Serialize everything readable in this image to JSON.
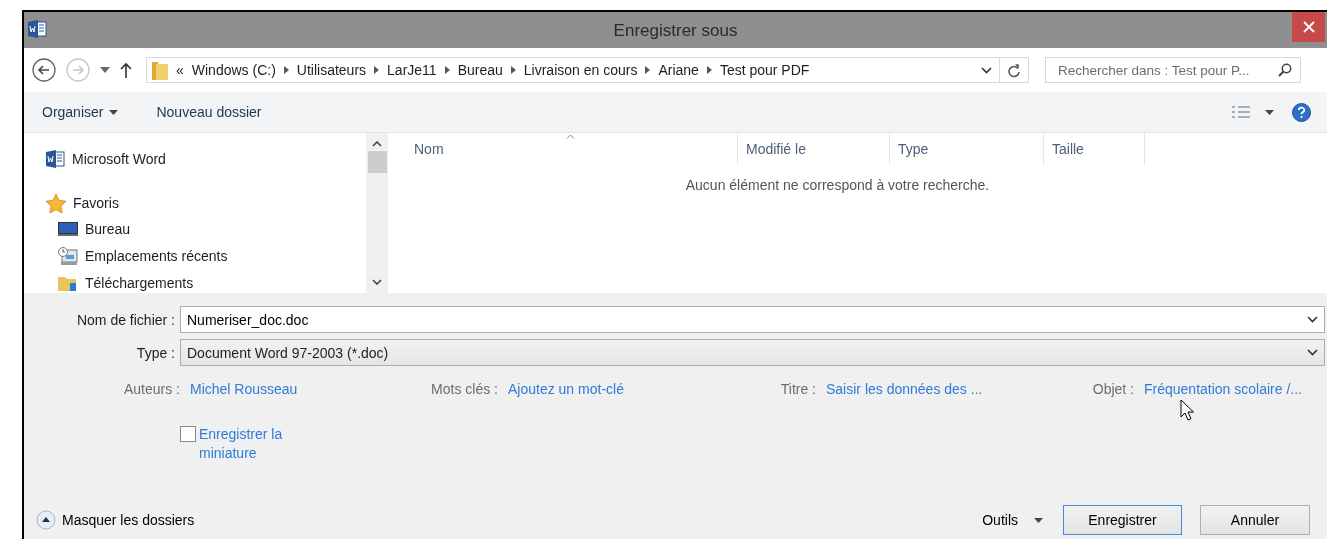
{
  "window": {
    "title": "Enregistrer sous"
  },
  "address": {
    "overflow": "«",
    "segments": [
      "Windows (C:)",
      "Utilisateurs",
      "LarJe11",
      "Bureau",
      "Livraison en cours",
      "Ariane",
      "Test pour PDF"
    ]
  },
  "search": {
    "placeholder": "Rechercher dans : Test pour P..."
  },
  "toolbar": {
    "organize": "Organiser",
    "new_folder": "Nouveau dossier"
  },
  "nav_pane": {
    "items": [
      {
        "label": "Microsoft Word",
        "kind": "word"
      },
      {
        "label": "Favoris",
        "kind": "star",
        "children": [
          {
            "label": "Bureau",
            "kind": "desktop"
          },
          {
            "label": "Emplacements récents",
            "kind": "recent"
          },
          {
            "label": "Téléchargements",
            "kind": "downloads"
          }
        ]
      }
    ]
  },
  "file_list": {
    "columns": [
      "Nom",
      "Modifié le",
      "Type",
      "Taille"
    ],
    "empty_message": "Aucun élément ne correspond à votre recherche."
  },
  "filename": {
    "label": "Nom de fichier :",
    "value": "Numeriser_doc.doc"
  },
  "file_type": {
    "label": "Type :",
    "value": "Document Word 97-2003 (*.doc)"
  },
  "properties": [
    {
      "label": "Auteurs :",
      "value": "Michel Rousseau"
    },
    {
      "label": "Mots clés :",
      "value": "Ajoutez un mot-clé"
    },
    {
      "label": "Titre :",
      "value": "Saisir les données des ..."
    },
    {
      "label": "Objet :",
      "value": "Fréquentation scolaire /..."
    }
  ],
  "thumbnail": {
    "label": "Enregistrer la miniature",
    "checked": false
  },
  "hide_folders": "Masquer les dossiers",
  "tools": "Outils",
  "buttons": [
    {
      "label": "Enregistrer",
      "kind": "primary"
    },
    {
      "label": "Annuler",
      "kind": "secondary"
    }
  ]
}
